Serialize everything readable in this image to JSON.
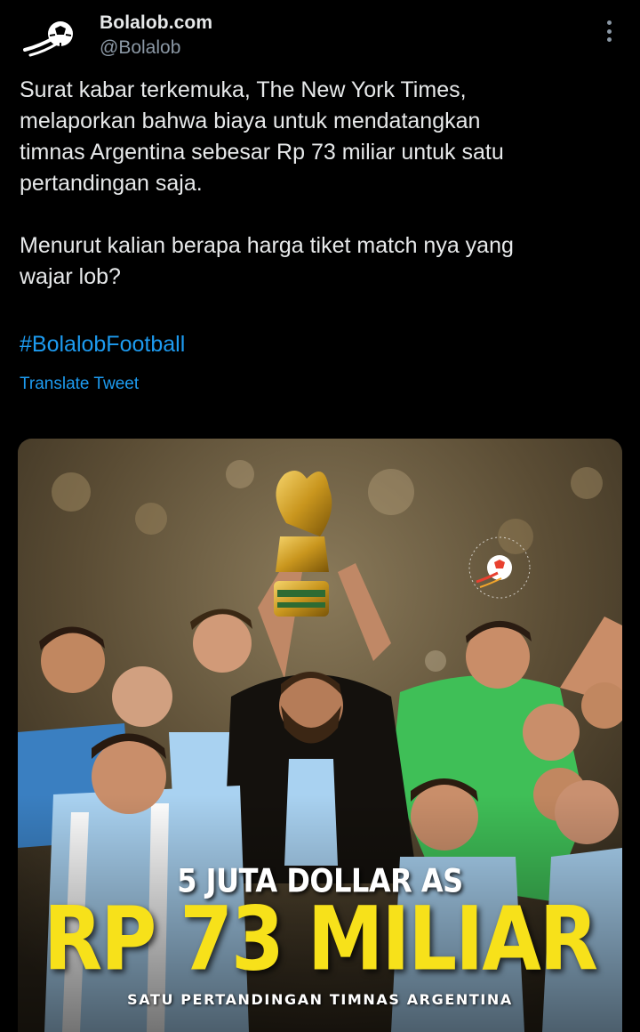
{
  "author": {
    "name": "Bolalob.com",
    "handle": "@Bolalob",
    "avatar_icon": "bolalob-logo-icon"
  },
  "menu": {
    "icon": "more-vertical-icon"
  },
  "tweet": {
    "paragraph1": [
      "Surat kabar terkemuka, The New York Times,",
      "melaporkan bahwa biaya untuk mendatangkan",
      "timnas Argentina sebesar Rp 73 miliar untuk satu",
      "pertandingan saja."
    ],
    "paragraph2": [
      "Menurut kalian berapa harga tiket match nya yang",
      "wajar lob?"
    ],
    "hashtag": "#BolalobFootball",
    "translate_label": "Translate Tweet"
  },
  "media": {
    "caption_small": "5 JUTA DOLLAR AS",
    "caption_big": "RP 73 MILIAR",
    "caption_sub": "SATU PERTANDINGAN TIMNAS ARGENTINA",
    "watermark_text": "BOLALOB FOOTBALL"
  },
  "colors": {
    "background": "#000000",
    "text": "#e7e9ea",
    "secondary": "#8b98a5",
    "link": "#1d9bf0",
    "caption_yellow": "#f7e11a"
  }
}
